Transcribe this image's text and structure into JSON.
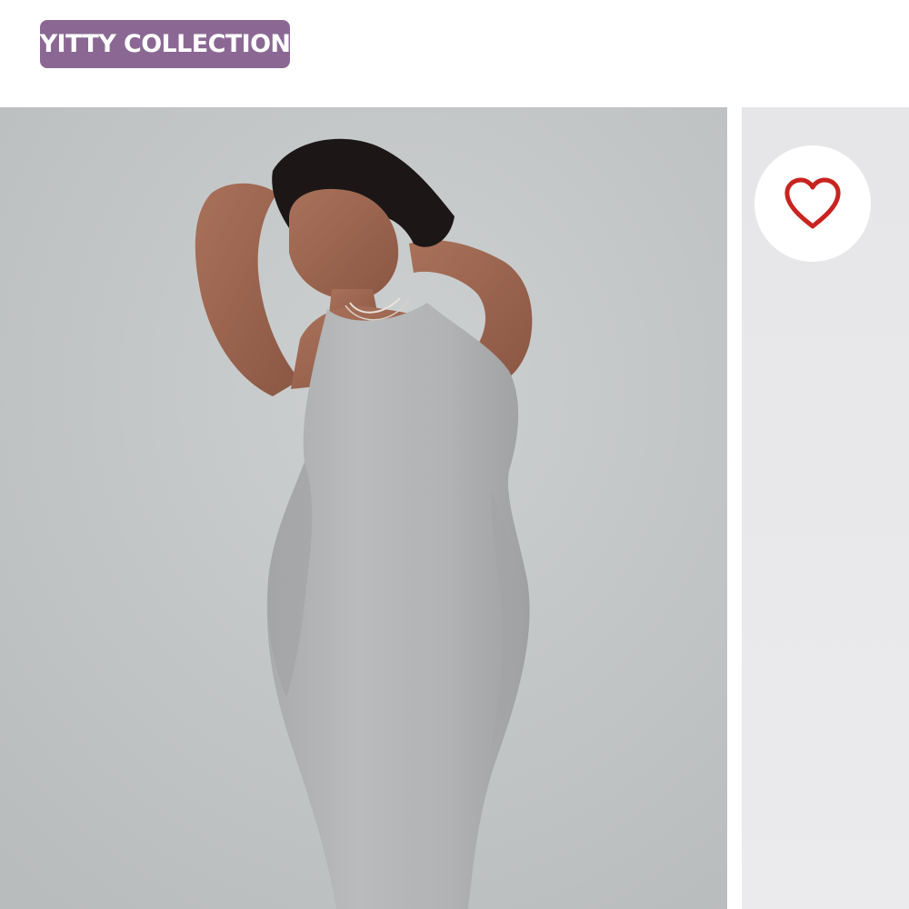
{
  "badge": {
    "label": "YITTY COLLECTION",
    "color": "#8b6893"
  },
  "product_image": {
    "alt": "Model wearing a grey sleeveless ribbed maxi dress"
  },
  "wishlist": {
    "icon": "heart-outline-icon",
    "icon_color": "#c8241f"
  }
}
